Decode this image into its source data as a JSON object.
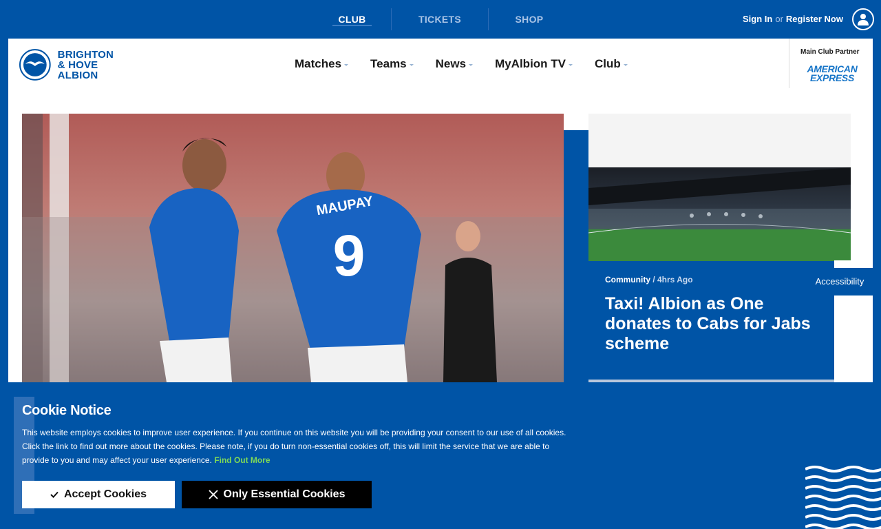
{
  "topbar": {
    "nav": [
      "CLUB",
      "TICKETS",
      "SHOP"
    ],
    "signin": "Sign In",
    "or": "or",
    "register": "Register Now"
  },
  "header": {
    "logo_line1": "BRIGHTON",
    "logo_line2": "& HOVE ALBION",
    "nav": [
      "Matches",
      "Teams",
      "News",
      "MyAlbion TV",
      "Club"
    ],
    "partner_label": "Main Club Partner",
    "partner_line1": "AMERICAN",
    "partner_line2": "EXPRESS"
  },
  "hero": {
    "shirt_name": "MAUPAY",
    "shirt_number": "9"
  },
  "side_article": {
    "category": "Community",
    "time": "/ 4hrs Ago",
    "title": "Taxi! Albion as One donates to Cabs for Jabs scheme"
  },
  "accessibility": "Accessibility",
  "cookie": {
    "title": "Cookie Notice",
    "text": "This website employs cookies to improve user experience. If you continue on this website you will be providing your consent to our use of all cookies. Click the link to find out more about the cookies. Please note, if you do turn non-essential cookies off, this will limit the service that we are able to provide to you and may affect your user experience.",
    "link": "Find Out More",
    "accept": "Accept Cookies",
    "essential": "Only Essential Cookies"
  },
  "colors": {
    "brand_blue": "#0054a6",
    "link_green": "#7ed957"
  }
}
